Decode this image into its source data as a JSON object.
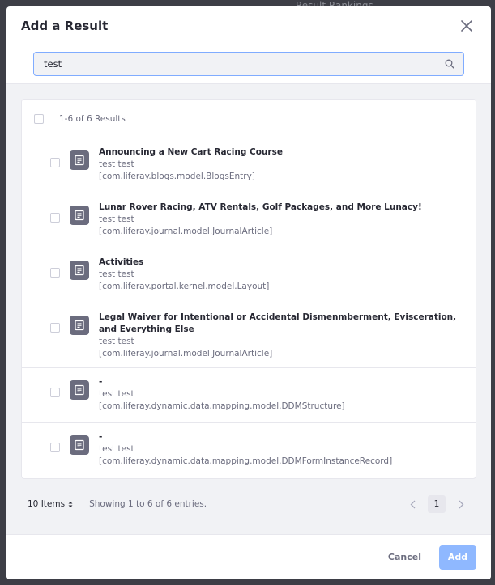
{
  "backdrop": {
    "text": "Result Rankings"
  },
  "modal": {
    "title": "Add a Result",
    "close_icon": "close-icon"
  },
  "search": {
    "value": "test",
    "placeholder": "",
    "icon": "search-icon"
  },
  "results": {
    "count_label": "1-6 of 6 Results",
    "items": [
      {
        "title": "Announcing a New Cart Racing Course",
        "author": "test test",
        "type": "[com.liferay.blogs.model.BlogsEntry]"
      },
      {
        "title": "Lunar Rover Racing, ATV Rentals, Golf Packages, and More Lunacy!",
        "author": "test test",
        "type": "[com.liferay.journal.model.JournalArticle]"
      },
      {
        "title": "Activities",
        "author": "test test",
        "type": "[com.liferay.portal.kernel.model.Layout]"
      },
      {
        "title": "Legal Waiver for Intentional or Accidental Dismenmberment, Evisceration, and Everything Else",
        "author": "test test",
        "type": "[com.liferay.journal.model.JournalArticle]"
      },
      {
        "title": "-",
        "author": "test test",
        "type": "[com.liferay.dynamic.data.mapping.model.DDMStructure]"
      },
      {
        "title": "-",
        "author": "test test",
        "type": "[com.liferay.dynamic.data.mapping.model.DDMFormInstanceRecord]"
      }
    ]
  },
  "pagination": {
    "items_per_page": "10 Items",
    "showing": "Showing 1 to 6 of 6 entries.",
    "current_page": "1"
  },
  "footer": {
    "cancel_label": "Cancel",
    "add_label": "Add"
  },
  "colors": {
    "primary_disabled": "#8fb8ff",
    "focus_border": "#80acff",
    "sticker": "#6b6c7e"
  }
}
